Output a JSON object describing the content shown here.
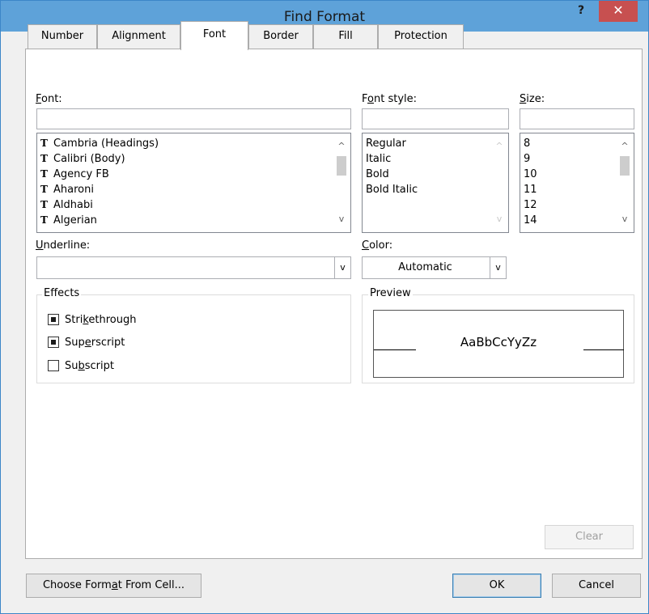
{
  "window": {
    "title": "Find Format",
    "help_glyph": "?",
    "close_glyph": "✕"
  },
  "tabs": [
    {
      "label": "Number",
      "active": false
    },
    {
      "label": "Alignment",
      "active": false
    },
    {
      "label": "Font",
      "active": true
    },
    {
      "label": "Border",
      "active": false
    },
    {
      "label": "Fill",
      "active": false
    },
    {
      "label": "Protection",
      "active": false
    }
  ],
  "font": {
    "label": "Font:",
    "label_accel": "F",
    "label_rest": "ont:",
    "value": "",
    "items": [
      "Cambria (Headings)",
      "Calibri (Body)",
      "Agency FB",
      "Aharoni",
      "Aldhabi",
      "Algerian"
    ],
    "item_icon": "truetype-font-icon",
    "item_icon_glyph": "T"
  },
  "font_style": {
    "label_pre": "F",
    "label_accel": "o",
    "label_rest": "nt style:",
    "value": "",
    "items": [
      "Regular",
      "Italic",
      "Bold",
      "Bold Italic"
    ]
  },
  "size": {
    "label_accel": "S",
    "label_rest": "ize:",
    "value": "",
    "items": [
      "8",
      "9",
      "10",
      "11",
      "12",
      "14"
    ]
  },
  "underline": {
    "label_accel": "U",
    "label_rest": "nderline:",
    "value": ""
  },
  "color": {
    "label_accel": "C",
    "label_rest": "olor:",
    "value": "Automatic"
  },
  "effects": {
    "title": "Effects",
    "strikethrough": {
      "pre": "Stri",
      "accel": "k",
      "post": "ethrough",
      "state": "indeterminate"
    },
    "superscript": {
      "pre": "Sup",
      "accel": "e",
      "post": "rscript",
      "state": "indeterminate"
    },
    "subscript": {
      "pre": "Su",
      "accel": "b",
      "post": "script",
      "state": "unchecked"
    }
  },
  "preview": {
    "title": "Preview",
    "sample": "AaBbCcYyZz"
  },
  "buttons": {
    "clear": "Clear",
    "choose_pre": "Choose Form",
    "choose_accel": "a",
    "choose_post": "t From Cell...",
    "ok": "OK",
    "cancel": "Cancel"
  },
  "icons": {
    "scroll_up": "^",
    "scroll_down": "v",
    "dropdown": "v"
  }
}
